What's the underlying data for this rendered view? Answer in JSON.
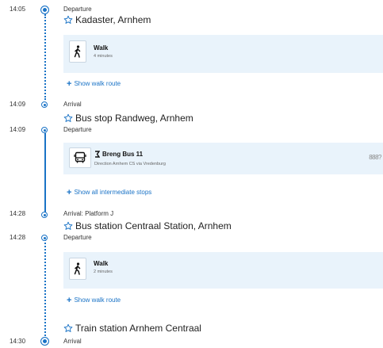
{
  "legs": [
    {
      "departure": {
        "time": "14:05",
        "label": "Departure",
        "place": "Kadaster, Arnhem"
      },
      "card": {
        "icon": "walk-icon",
        "title": "Walk",
        "subtitle": "4 minutes"
      },
      "link": "Show walk route"
    },
    {
      "arrival": {
        "time": "14:09",
        "label": "Arrival",
        "place": "Bus stop Randweg, Arnhem"
      },
      "departure": {
        "time": "14:09",
        "label": "Departure"
      },
      "card": {
        "icon": "bus-icon",
        "title": "Breng Bus 11",
        "subtitle": "Direction Arnhem CS via Vredenburg",
        "crowd": "888?"
      },
      "link": "Show all intermediate stops"
    },
    {
      "arrival": {
        "time": "14:28",
        "label": "Arrival: Platform J",
        "place": "Bus station Centraal Station, Arnhem"
      },
      "departure": {
        "time": "14:28",
        "label": "Departure"
      },
      "card": {
        "icon": "walk-icon",
        "title": "Walk",
        "subtitle": "2 minutes"
      },
      "link": "Show walk route"
    }
  ],
  "final": {
    "place": "Train station Arnhem Centraal",
    "time": "14:30",
    "label": "Arrival"
  },
  "colors": {
    "accent": "#1a73c6",
    "card_bg": "#e9f3fb"
  }
}
